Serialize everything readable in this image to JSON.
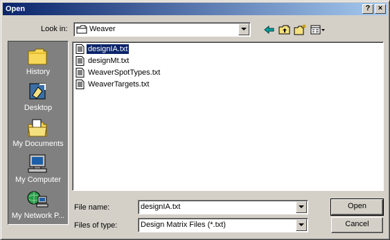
{
  "window": {
    "title": "Open",
    "help_label": "?",
    "close_label": "×"
  },
  "lookin": {
    "label": "Look in:",
    "value": "Weaver"
  },
  "places": [
    {
      "label": "History",
      "icon": "history-icon"
    },
    {
      "label": "Desktop",
      "icon": "desktop-icon"
    },
    {
      "label": "My Documents",
      "icon": "my-documents-icon"
    },
    {
      "label": "My Computer",
      "icon": "my-computer-icon"
    },
    {
      "label": "My Network P...",
      "icon": "my-network-places-icon"
    }
  ],
  "files": [
    {
      "name": "designIA.txt",
      "selected": true
    },
    {
      "name": "designMt.txt",
      "selected": false
    },
    {
      "name": "WeaverSpotTypes.txt",
      "selected": false
    },
    {
      "name": "WeaverTargets.txt",
      "selected": false
    }
  ],
  "filename": {
    "label": "File name:",
    "value": "designIA.txt"
  },
  "filetype": {
    "label": "Files of type:",
    "value": "Design Matrix Files (*.txt)"
  },
  "buttons": {
    "open": "Open",
    "cancel": "Cancel"
  },
  "colors": {
    "title_start": "#0a246a",
    "title_end": "#a6caf0",
    "selection": "#0a246a",
    "face": "#d4d0c8"
  }
}
